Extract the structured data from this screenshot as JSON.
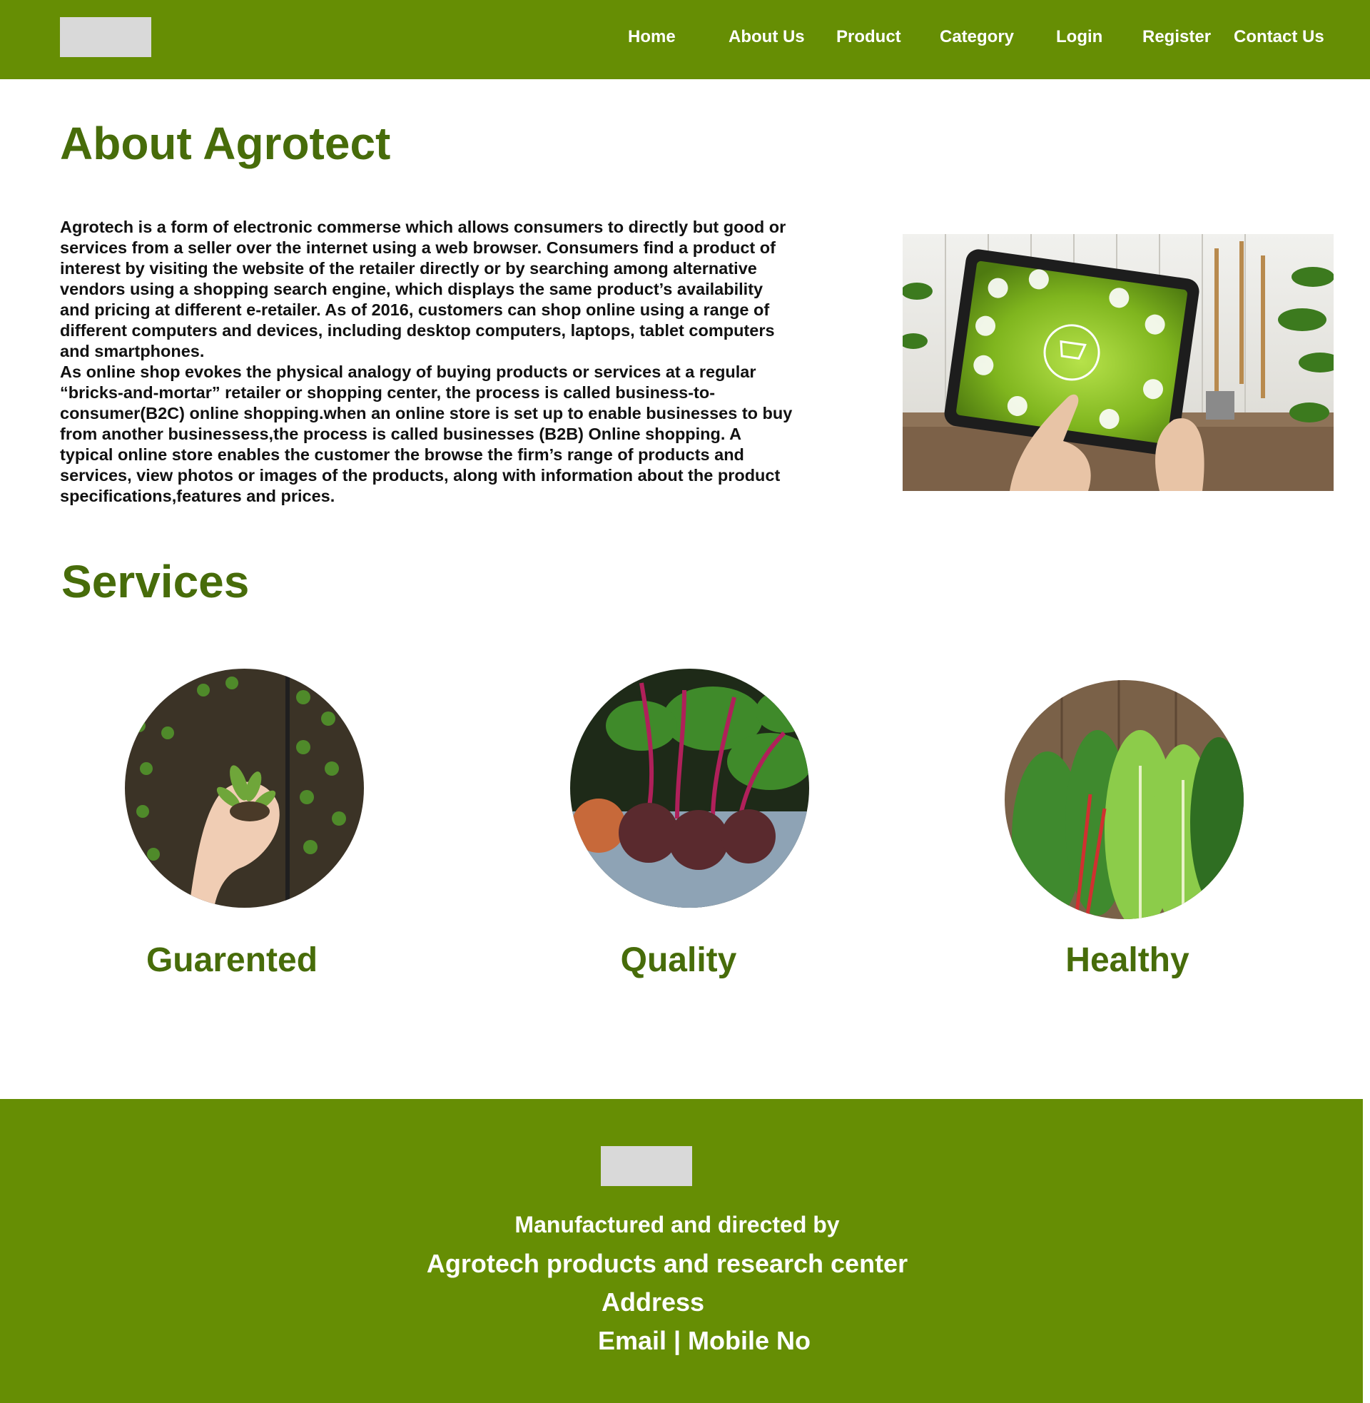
{
  "nav": {
    "home": "Home",
    "about": "About Us",
    "product": "Product",
    "category": "Category",
    "login": "Login",
    "register": "Register",
    "contact": "Contact Us"
  },
  "about": {
    "title": "About Agrotect",
    "paragraph1": "Agrotech is a form of electronic commerse which allows consumers to directly but good or services from a seller over the internet using a web browser. Consumers find a product of interest by visiting the website of the retailer directly or by searching among alternative vendors using a shopping search engine, which displays the same product’s availability and pricing at different e-retailer. As of 2016, customers can shop online using a range of different computers and devices, including desktop computers, laptops, tablet computers and smartphones.",
    "paragraph2": "As online shop evokes the physical analogy of buying products or services at a regular “bricks-and-mortar” retailer or shopping center, the process is called business-to-consumer(B2C) online shopping.when an online store is set up to enable businesses to buy from another businessess,the process is called businesses (B2B) Online shopping. A typical online store enables the customer the browse the firm’s range of products and services, view photos or images of the products, along with information about the product specifications,features and prices."
  },
  "services": {
    "title": "Services",
    "items": [
      {
        "label": "Guarented"
      },
      {
        "label": "Quality"
      },
      {
        "label": "Healthy"
      }
    ]
  },
  "footer": {
    "line1": "Manufactured and directed by",
    "line2": "Agrotech products and research center",
    "line3": "Address",
    "line4": "Email | Mobile No"
  },
  "colors": {
    "brand_green": "#668e04",
    "heading_green": "#476c0a",
    "placeholder_gray": "#d9d9d9"
  }
}
